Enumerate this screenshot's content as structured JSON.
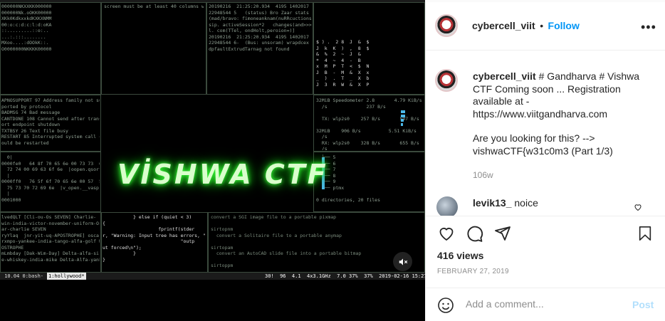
{
  "media": {
    "title": "VİSHWA CTF",
    "term_topleft": "000000NKXXKK000000\n000000Nk.oOKK00000\nXKk0KdkxxkdKXKXNMM\n00:o:c:d:c:l:d:oKA\n::.........::o:..\n...:.:::........\nMXoo....:dOOkK::.\nO0000000NKKKK00000",
    "term_topmid": "screen must be at least 40 columns wi",
    "term_topright1": "20190216  21:25:20.934  4195 1402017\n22948544 5   (status) Bro Zaar stats\n(mad/bravo: fimoneanknam(nuRRcuctions\nsip. activeSession*2   changes(and>>>\nl. com(TTel, ondHolt,peroion=)]\n20190216  21:25:20.934  4195 1402017\n22948544 6-  (Bus: unsoram) wrapdcex\ndpfaultExtrudTarnag not found",
    "term_matrix": "$ ) .  2 8  J  &  $\nJ  k  K  )  ,  8  $\n&  %  2  ~  J  &\n*  4  ~  4  -  B\nx  M  P  T  <  $  N\nJ  B  -  M  &  X  x\n_  )  .  T  _  X  b\nJ  3  R  W  &  X  P",
    "term_midleft": "APNOSUPPORT 97 Address family not su\nported by protocol\nBADMSG 74 Bad message\nCANTDONE 108 Cannot send after trans\nort endpoint shutdown\nTXTBSY 26 Text file busy\nRESTART 85 Interrupted system call s\nould be restarted",
    "term_speed": "32MiB Speedometer 2.8       4.79 KiB/s\n  /s              237 B/s\n\n  TX: wlp2s0    257 B/s       597 B/s   317\n\n32MiB    906 B/s          5.51 KiB/s\n  /s\n  RX: wlp2s0    328 B/s       655 B/s   594\n  /s                                    0 B/s",
    "term_hex": "  0|\n0000fe0   64 8f 70 65 6e 00 73 73  6f\n  72 74 00 69 63 6f 6e  |oopen.qsort i\n  |\n0000ff0   76 5f 6f 70 65 6e 00 57  5f\n  75 73 70 72 69 6e  |v_open.__vasp\n  |\n0001000",
    "term_dirs": "  ├── 5\n  ├── 6\n  ├── 7\n  ├── 8\n  ├── 9\n  └── ptmx\n\n0 directories, 20 files",
    "term_botleft": "lvedQLT [Cli-ou-Os SEVEN] Charlie-\nwin-india-victor-november-uniform-Os\nar-charlie SEVEN\nryYlaq  jnr-yit-uq-APOSTROPHE] oscar\nrxmpo-yankee-india-tango-alfa-golf W\nOSTROPHE\nmLmbday [Dak-Wim-Day] Delta-alfa-si\ne-whiskey-india-mike Delta-Alfa-yank",
    "term_botmid": "           } else if (quiet < 3)\n{\n                    fprintf(stder\nr, \"Warning: Input tree has errors, \"\n                            \"outp\nut forced\\n\");\n           }\n}",
    "term_botright": "convert a SGI image file to a portable pixmap\n\nsirtopnm\n  convert a Solitaire file to a portable anymap\n\nsirtopam\n  convert an AutoCAD slide file into a portable bitmap\n\nsirtoppm",
    "status_left": " 10.04 0:bash- ",
    "status_tab": "1:hollywood*",
    "status_right": "30!  96  4.1  4x3.1GHz  7.0 37%  37%  2019-02-16 15:27:21"
  },
  "account": {
    "username": "cybercell_viit",
    "separator": "•",
    "follow": "Follow",
    "more": "•••"
  },
  "caption": {
    "username": "cybercell_viit",
    "text": " # Gandharva # Vishwa CTF Coming soon ... Registration available at - https://www.viitgandharva.com",
    "text2": "Are you looking for this? --> vishwaCTF{w31c0m3 (Part 1/3)",
    "time": "106w"
  },
  "comment": {
    "username": "levik13_",
    "text": " noice"
  },
  "stats": {
    "views": "416 views",
    "date": "FEBRUARY 27, 2019"
  },
  "composer": {
    "placeholder": "Add a comment...",
    "post": "Post"
  },
  "colors": {
    "accent": "#0095f6",
    "post_disabled": "#b2dffc",
    "glow": "#3cff3c"
  }
}
